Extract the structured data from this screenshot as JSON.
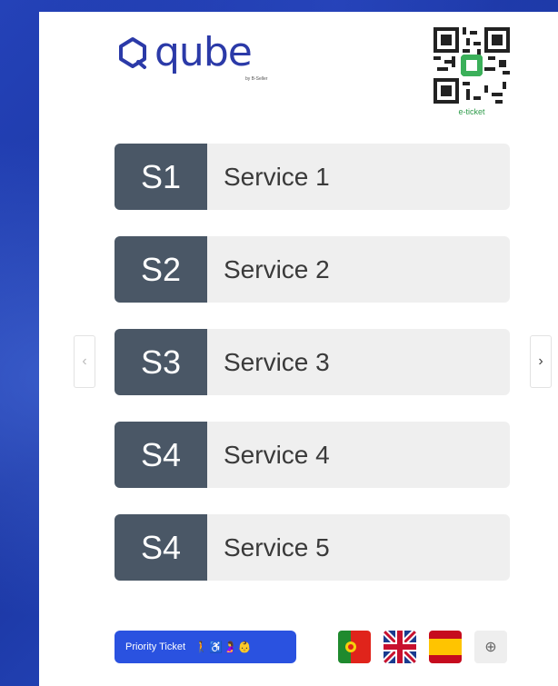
{
  "brand": {
    "logo_text": "qube",
    "logo_sub": "by B-Seller"
  },
  "eticket": {
    "label": "e-ticket"
  },
  "services": [
    {
      "code": "S1",
      "name": "Service 1"
    },
    {
      "code": "S2",
      "name": "Service 2"
    },
    {
      "code": "S3",
      "name": "Service 3"
    },
    {
      "code": "S4",
      "name": "Service 4"
    },
    {
      "code": "S4",
      "name": "Service 5"
    }
  ],
  "navigation": {
    "prev_icon": "chevron-left-icon",
    "next_icon": "chevron-right-icon"
  },
  "priority": {
    "label": "Priority Ticket"
  },
  "languages": [
    {
      "name": "Portuguese",
      "icon": "portugal-flag-icon"
    },
    {
      "name": "English",
      "icon": "uk-flag-icon"
    },
    {
      "name": "Spanish",
      "icon": "spain-flag-icon"
    },
    {
      "name": "Other",
      "icon": "globe-icon"
    }
  ],
  "colors": {
    "background": "#1f3fae",
    "brand": "#2b3aa8",
    "service_code_bg": "#4a5766",
    "service_bg": "#efefef",
    "priority_bg": "#2a52e0",
    "eticket_green": "#2e9b4a"
  }
}
